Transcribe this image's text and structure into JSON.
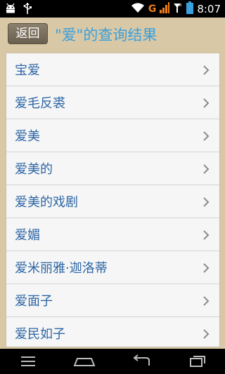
{
  "status_bar": {
    "time": "8:07",
    "network_label": "G",
    "icons": [
      "android-robot-icon",
      "usb-icon",
      "wifi-icon",
      "signal-icon",
      "roaming-icon",
      "battery-icon"
    ]
  },
  "header": {
    "back_label": "返回",
    "title": "\"爱\"的查询结果",
    "title_color": "#3aa0dc"
  },
  "results": [
    {
      "label": "宝爱"
    },
    {
      "label": "爱毛反裘"
    },
    {
      "label": "爱美"
    },
    {
      "label": "爱美的"
    },
    {
      "label": "爱美的戏剧"
    },
    {
      "label": "爱媚"
    },
    {
      "label": "爱米丽雅·迦洛蒂"
    },
    {
      "label": "爱面子"
    },
    {
      "label": "爱民如子"
    }
  ],
  "colors": {
    "background": "#d9c8a6",
    "item_text": "#2d66a5",
    "accent": "#3aa0dc"
  },
  "nav_bar": {
    "icons": [
      "menu-icon",
      "home-icon",
      "back-icon",
      "recent-apps-icon"
    ]
  }
}
